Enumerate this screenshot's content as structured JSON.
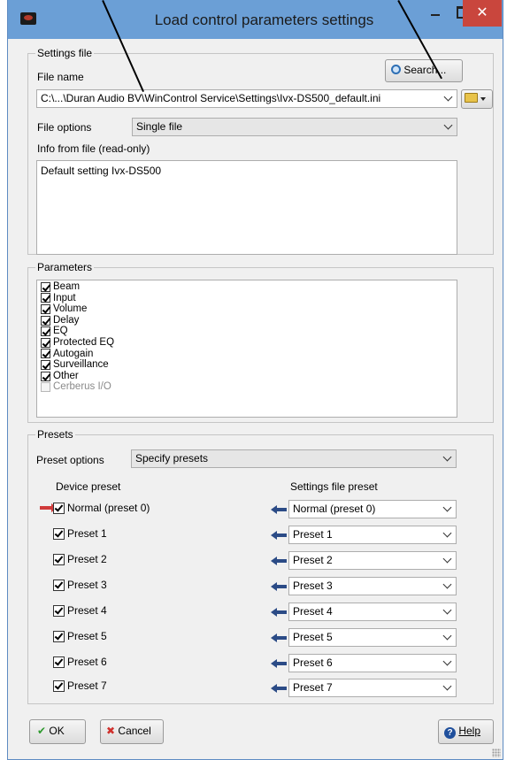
{
  "window": {
    "title": "Load control parameters settings",
    "close_glyph": "✕"
  },
  "settings_file": {
    "group_label": "Settings file",
    "file_name_label": "File name",
    "search_label": "Search...",
    "file_path": "C:\\...\\Duran Audio BV\\WinControl Service\\Settings\\Ivx-DS500_default.ini",
    "file_options_label": "File options",
    "file_options_value": "Single file",
    "info_label": "Info from file (read-only)",
    "info_text": "Default setting Ivx-DS500"
  },
  "parameters": {
    "group_label": "Parameters",
    "items": [
      {
        "label": "Beam",
        "checked": true
      },
      {
        "label": "Input",
        "checked": true
      },
      {
        "label": "Volume",
        "checked": true
      },
      {
        "label": "Delay",
        "checked": true
      },
      {
        "label": "EQ",
        "checked": true
      },
      {
        "label": "Protected EQ",
        "checked": true
      },
      {
        "label": "Autogain",
        "checked": true
      },
      {
        "label": "Surveillance",
        "checked": true
      },
      {
        "label": "Other",
        "checked": true
      },
      {
        "label": "Cerberus I/O",
        "checked": false
      }
    ]
  },
  "presets": {
    "group_label": "Presets",
    "preset_options_label": "Preset options",
    "preset_options_value": "Specify presets",
    "device_preset_header": "Device preset",
    "settings_file_preset_header": "Settings file preset",
    "rows": [
      {
        "device": "Normal (preset 0)",
        "file": "Normal (preset 0)"
      },
      {
        "device": "Preset 1",
        "file": "Preset 1"
      },
      {
        "device": "Preset 2",
        "file": "Preset 2"
      },
      {
        "device": "Preset 3",
        "file": "Preset 3"
      },
      {
        "device": "Preset 4",
        "file": "Preset 4"
      },
      {
        "device": "Preset 5",
        "file": "Preset 5"
      },
      {
        "device": "Preset 6",
        "file": "Preset 6"
      },
      {
        "device": "Preset 7",
        "file": "Preset 7"
      }
    ]
  },
  "buttons": {
    "ok": "OK",
    "cancel": "Cancel",
    "help": "Help"
  },
  "colors": {
    "titlebar": "#6b9fd6",
    "close_button": "#c9463d",
    "arrow_blue": "#2b4b86",
    "arrow_red": "#d03a3a"
  }
}
